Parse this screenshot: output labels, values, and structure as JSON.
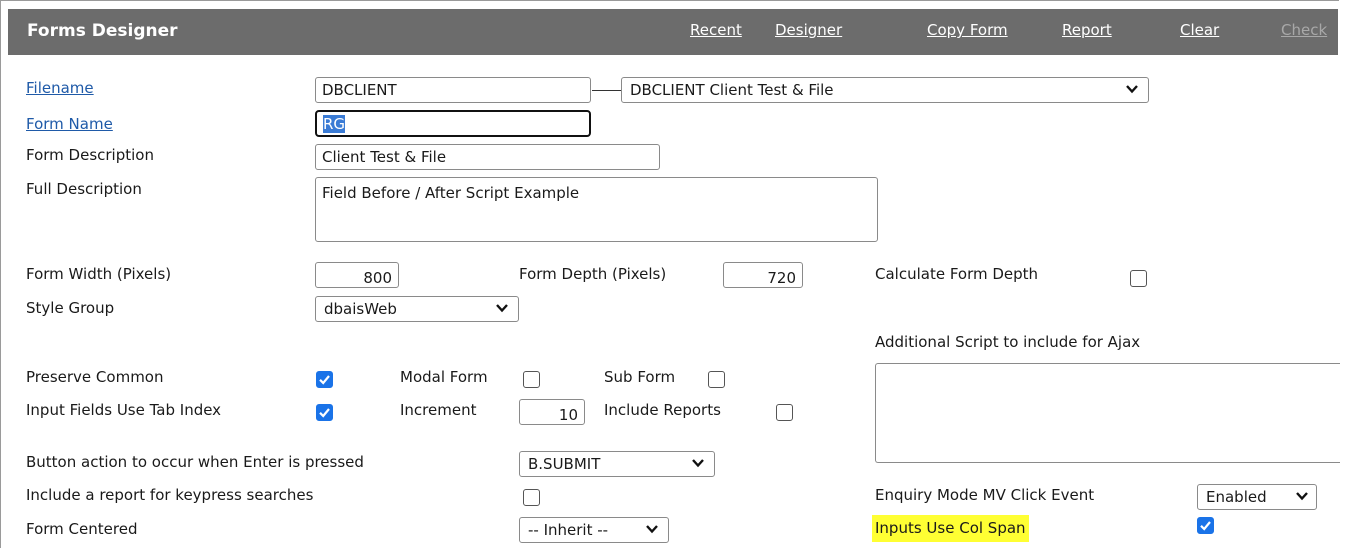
{
  "header": {
    "title": "Forms Designer",
    "nav": [
      "Recent",
      "Designer",
      "Copy Form",
      "Report",
      "Clear",
      "Check"
    ]
  },
  "fields": {
    "filename": {
      "label": "Filename",
      "value": "DBCLIENT",
      "select": "DBCLIENT Client Test & File"
    },
    "form_name": {
      "label": "Form Name",
      "value": "RG"
    },
    "form_description": {
      "label": "Form Description",
      "value": "Client Test & File"
    },
    "full_description": {
      "label": "Full Description",
      "value": "Field Before / After Script Example"
    },
    "form_width": {
      "label": "Form Width (Pixels)",
      "value": "800"
    },
    "form_depth": {
      "label": "Form Depth (Pixels)",
      "value": "720"
    },
    "calculate_form_depth": {
      "label": "Calculate Form Depth",
      "checked": false
    },
    "style_group": {
      "label": "Style Group",
      "value": "dbaisWeb"
    },
    "additional_script": {
      "label": "Additional Script to include for Ajax",
      "value": ""
    },
    "preserve_common": {
      "label": "Preserve Common",
      "checked": true
    },
    "modal_form": {
      "label": "Modal Form",
      "checked": false
    },
    "sub_form": {
      "label": "Sub Form",
      "checked": false
    },
    "input_tab_index": {
      "label": "Input Fields Use Tab Index",
      "checked": true
    },
    "increment": {
      "label": "Increment",
      "value": "10"
    },
    "include_reports": {
      "label": "Include Reports",
      "checked": false
    },
    "enter_action": {
      "label": "Button action to occur when Enter is pressed",
      "value": "B.SUBMIT"
    },
    "keypress_report": {
      "label": "Include a report for keypress searches",
      "checked": false
    },
    "enquiry_mode": {
      "label": "Enquiry Mode MV Click Event",
      "value": "Enabled"
    },
    "form_centered": {
      "label": "Form Centered",
      "value": "-- Inherit --"
    },
    "inputs_col_span": {
      "label": "Inputs Use Col Span",
      "checked": true
    }
  },
  "colors": {
    "header_bg": "#6c6c6c",
    "link": "#1f5aa8",
    "checkbox": "#1a73e8",
    "highlight": "#ffff33"
  }
}
